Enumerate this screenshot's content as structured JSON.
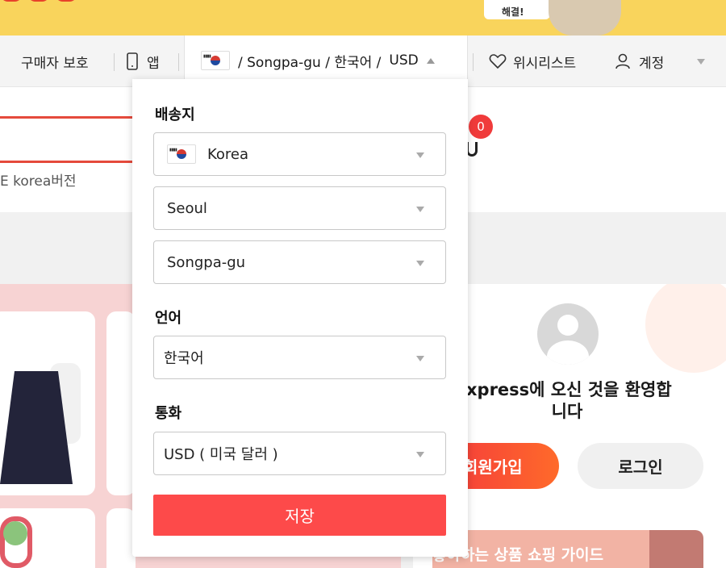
{
  "banner": {
    "sign_text": "해결!"
  },
  "topbar": {
    "buyer_protection": "구매자 보호",
    "app": "앱",
    "location_summary": "/ Songpa-gu / 한국어 /",
    "currency_code": "USD",
    "wishlist": "위시리스트",
    "account": "계정"
  },
  "search": {
    "hint": "E korea버전"
  },
  "cart": {
    "count": "0"
  },
  "dropdown": {
    "ship_to_label": "배송지",
    "country": "Korea",
    "city": "Seoul",
    "district": "Songpa-gu",
    "language_label": "언어",
    "language": "한국어",
    "currency_label": "통화",
    "currency": "USD ( 미국 달러 )",
    "save": "저장"
  },
  "welcome": {
    "title_line1": "xpress에 오신 것을 환영합",
    "title_line2": "니다",
    "join": "회원가입",
    "login": "로그인",
    "guide": "좋아하는 상품 쇼핑 가이드"
  },
  "colors": {
    "accent": "#fd4a4a",
    "banner": "#f9d45c",
    "badge": "#f03b3b"
  },
  "icons": [
    "phone-icon",
    "flag-kr-icon",
    "heart-icon",
    "user-icon",
    "chevron-down-icon",
    "chevron-up-icon",
    "cart-icon"
  ]
}
